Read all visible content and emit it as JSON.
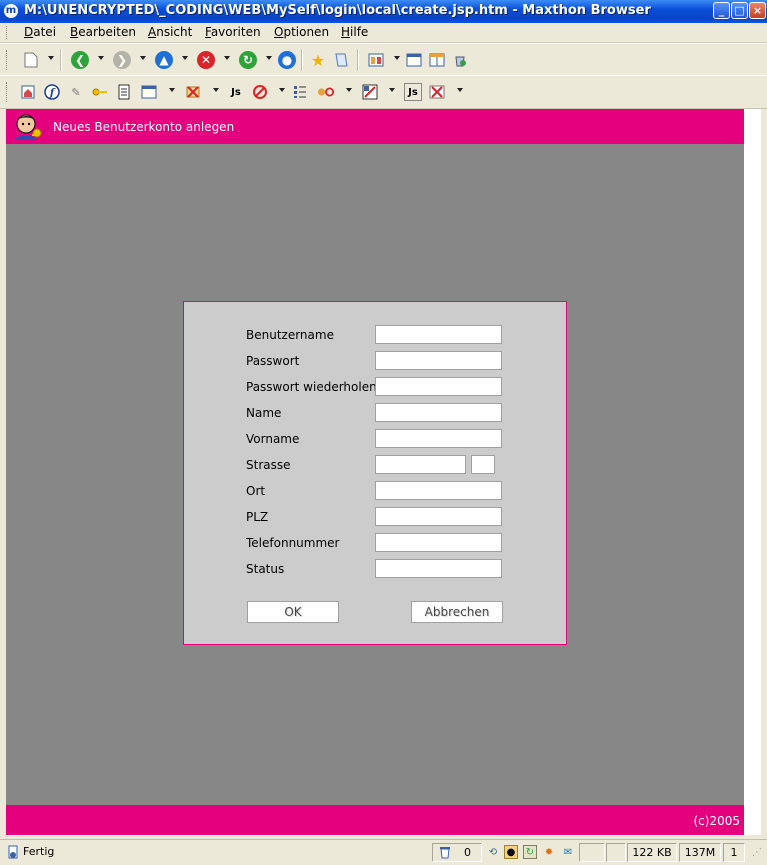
{
  "window": {
    "title": "M:\\UNENCRYPTED\\_CODING\\WEB\\MySelf\\login\\local\\create.jsp.htm - Maxthon Browser",
    "app_icon": "maxthon-icon",
    "buttons": [
      "minimize",
      "maximize",
      "close"
    ]
  },
  "menu": {
    "items": [
      {
        "first": "D",
        "rest": "atei"
      },
      {
        "first": "B",
        "rest": "earbeiten"
      },
      {
        "first": "A",
        "rest": "nsicht"
      },
      {
        "first": "F",
        "rest": "avoriten"
      },
      {
        "first": "O",
        "rest": "ptionen"
      },
      {
        "first": "H",
        "rest": "ilfe"
      }
    ]
  },
  "toolbar2": {
    "js_label": "Js"
  },
  "page": {
    "header_title": "Neues Benutzerkonto anlegen",
    "footer_text": "(c)2005",
    "accent_color": "#e5007e",
    "form": {
      "fields": [
        {
          "label": "Benutzername",
          "value": ""
        },
        {
          "label": "Passwort",
          "value": ""
        },
        {
          "label": "Passwort wiederholen",
          "value": ""
        },
        {
          "label": "Name",
          "value": ""
        },
        {
          "label": "Vorname",
          "value": ""
        },
        {
          "label": "Strasse",
          "value": "",
          "number_value": ""
        },
        {
          "label": "Ort",
          "value": ""
        },
        {
          "label": "PLZ",
          "value": ""
        },
        {
          "label": "Telefonnummer",
          "value": ""
        },
        {
          "label": "Status",
          "value": ""
        }
      ],
      "ok_label": "OK",
      "cancel_label": "Abbrechen"
    }
  },
  "status": {
    "text": "Fertig",
    "popup_count": "0",
    "size": "122 KB",
    "memory": "137M",
    "tabs": "1"
  }
}
